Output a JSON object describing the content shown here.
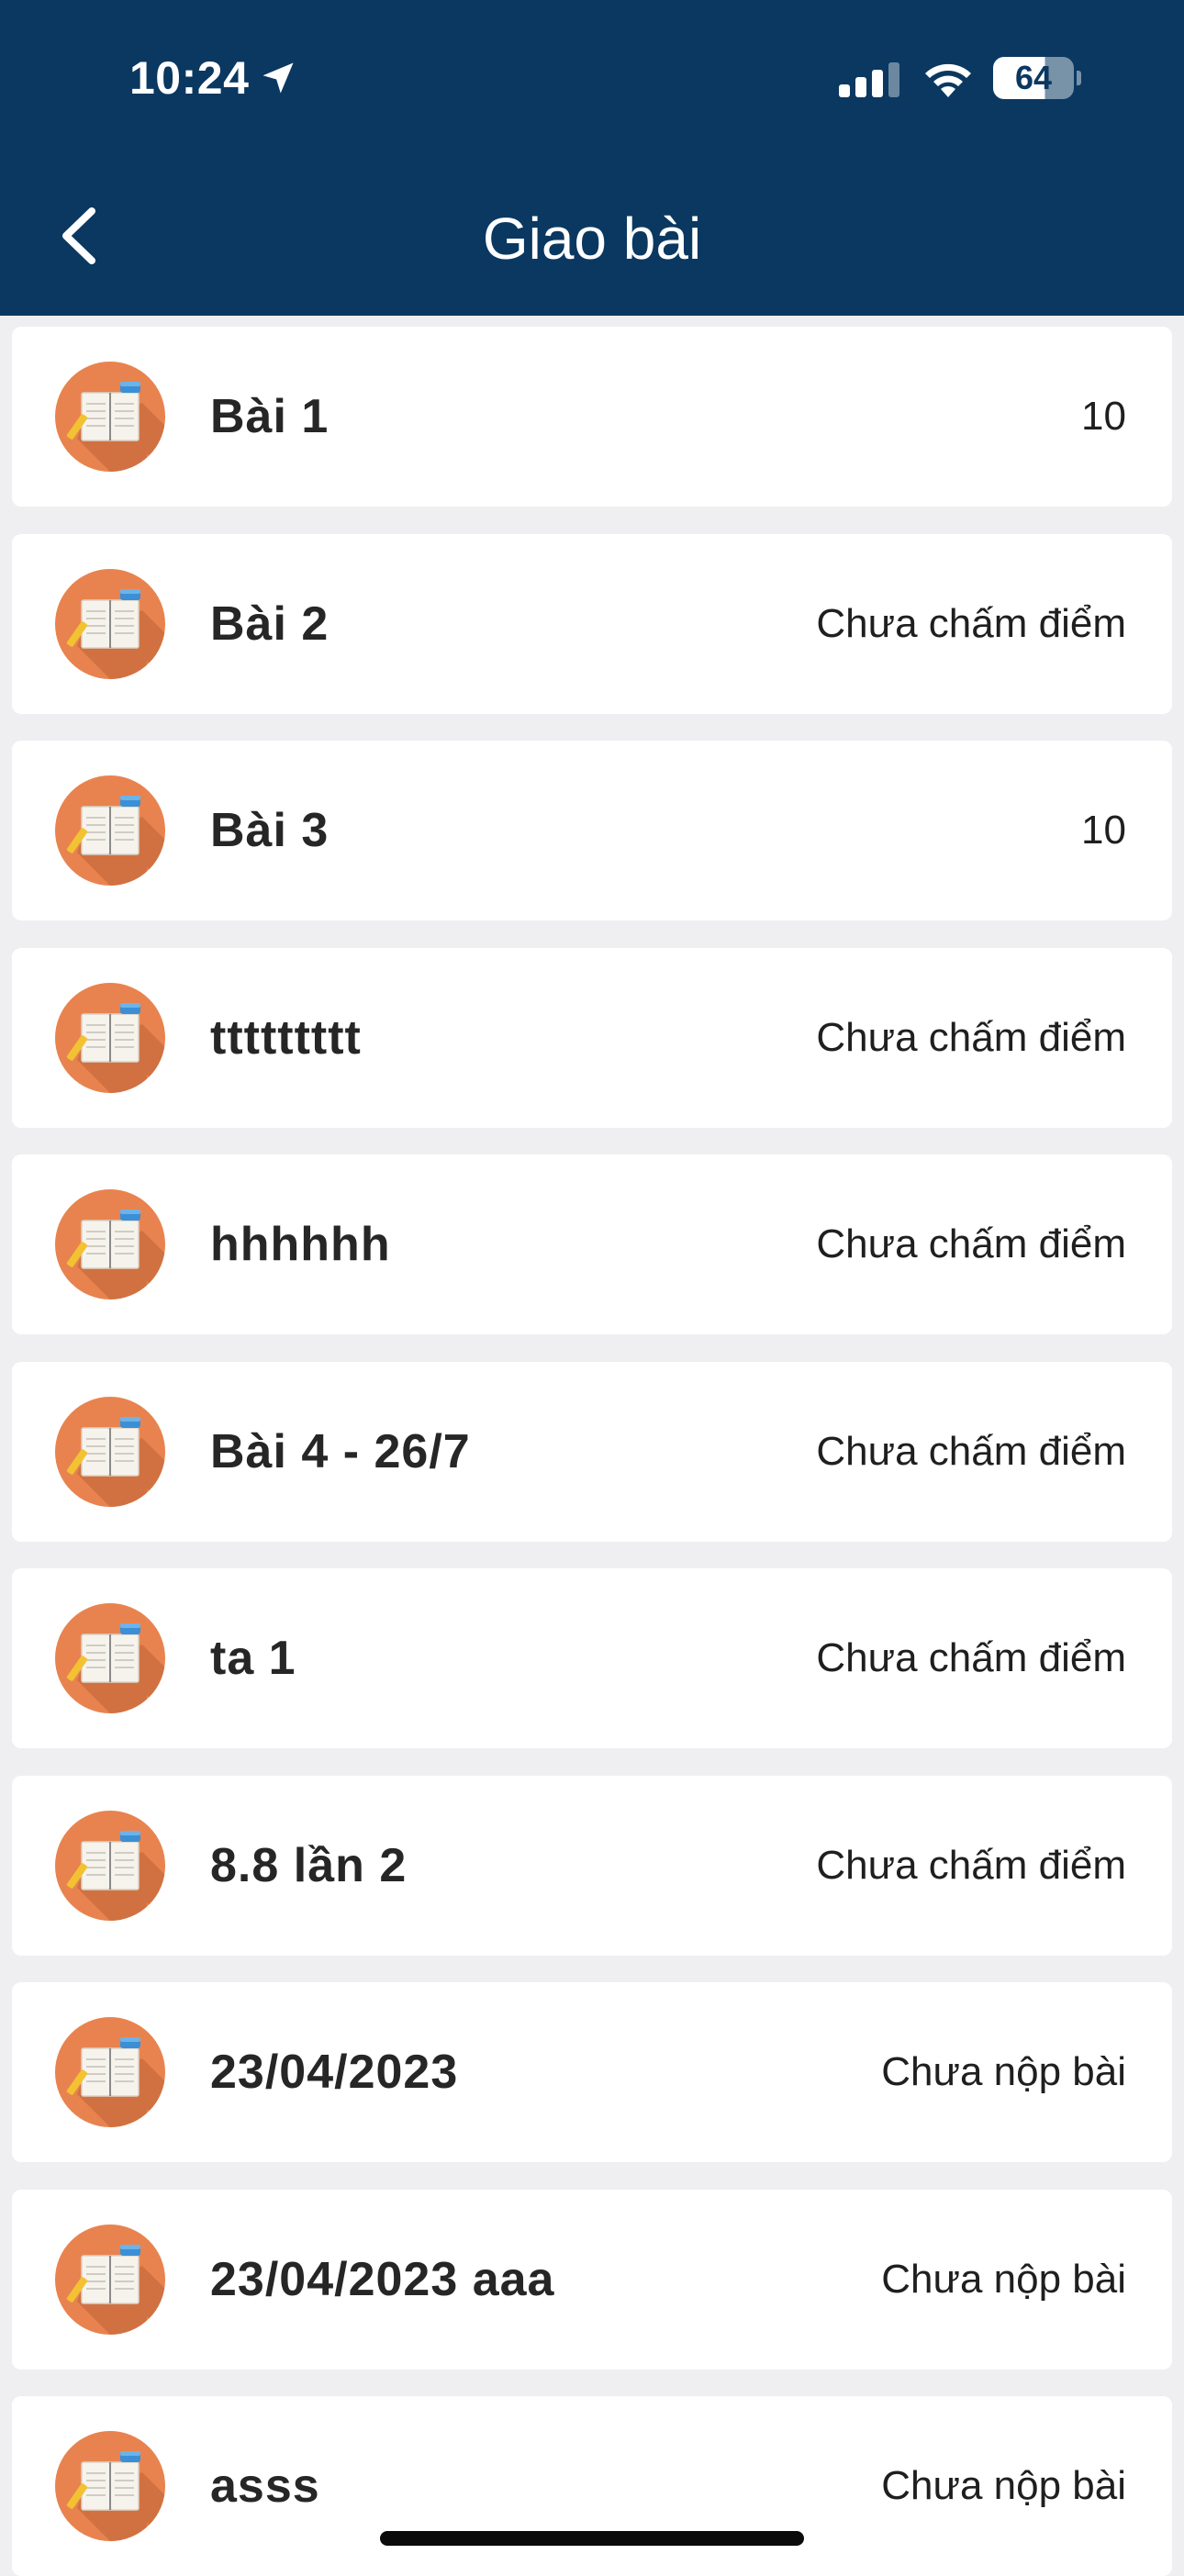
{
  "status_bar": {
    "time": "10:24",
    "battery": "64"
  },
  "header": {
    "title": "Giao bài"
  },
  "items": [
    {
      "title": "Bài 1",
      "status": "10"
    },
    {
      "title": "Bài 2",
      "status": "Chưa chấm điểm"
    },
    {
      "title": "Bài 3",
      "status": "10"
    },
    {
      "title": "ttttttttt",
      "status": "Chưa chấm điểm"
    },
    {
      "title": "hhhhhh",
      "status": "Chưa chấm điểm"
    },
    {
      "title": "Bài 4 - 26/7",
      "status": "Chưa chấm điểm"
    },
    {
      "title": "ta 1",
      "status": "Chưa chấm điểm"
    },
    {
      "title": "8.8 lần 2",
      "status": "Chưa chấm điểm"
    },
    {
      "title": "23/04/2023",
      "status": "Chưa nộp bài"
    },
    {
      "title": "23/04/2023 aaa",
      "status": "Chưa nộp bài"
    },
    {
      "title": "asss",
      "status": "Chưa nộp bài"
    }
  ],
  "icons": {
    "back": "chevron-left-icon",
    "item": "notebook-pencil-icon"
  },
  "colors": {
    "header_bg": "#0a3861",
    "avatar_bg": "#e8834f",
    "page_bg": "#efeff1"
  }
}
